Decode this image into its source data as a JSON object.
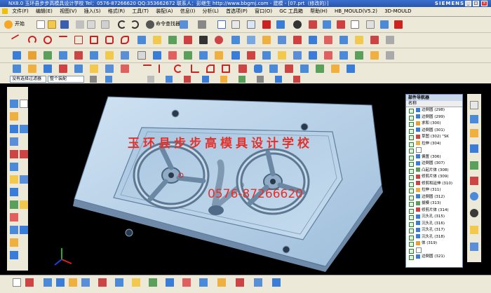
{
  "window": {
    "title": "NX8.0 玉环县步步高模具设计学校   Tel：0576-87266620 QQ:353662672  联系人：彭继生  http://www.bbgmj.com - 建模 - [07.prt（修改的）]",
    "brand": "SIEMENS",
    "controls": [
      "_",
      "□",
      "×"
    ]
  },
  "menu": [
    "文件(F)",
    "编辑(E)",
    "视图(V)",
    "插入(S)",
    "格式(R)",
    "工具(T)",
    "装配(A)",
    "信息(I)",
    "分析(L)",
    "首选项(P)",
    "窗口(O)",
    "GC 工具箱",
    "帮助(H)",
    "HB_MOULD(V5.2)",
    "3D-MOULD"
  ],
  "toolbar": {
    "start_label": "开始",
    "command_finder_label": "命令查找器"
  },
  "selection_bar": {
    "filter_value": "没有选择过滤器",
    "scope_value": "整个装配"
  },
  "viewport": {
    "watermark_school": "玉环县步步高模具设计学校",
    "watermark_phone": "0576-87266620",
    "background_color": "#000000",
    "plate_color": "#bfd7ea",
    "watermark_color": "#e3312b"
  },
  "part_navigator": {
    "title": "部件导航器",
    "column": "名称",
    "items": [
      "边倒圆 (298)",
      "边倒圆 (299)",
      "求和 (300)",
      "边倒圆 (301)",
      "草图 (302) \"SK",
      "拉伸 (304)",
      "",
      "偏置 (306)",
      "边倒圆 (307)",
      "凸起片体 (308)",
      "修剪片体 (309)",
      "修剪和延伸 (310)",
      "拉伸 (311)",
      "边倒圆 (312)",
      "拔模 (313)",
      "修剪片体 (314)",
      "沉头孔 (315)",
      "沉头孔 (316)",
      "沉头孔 (317)",
      "沉头孔 (318)",
      "体 (319)",
      "",
      "边倒圆 (321)"
    ]
  }
}
